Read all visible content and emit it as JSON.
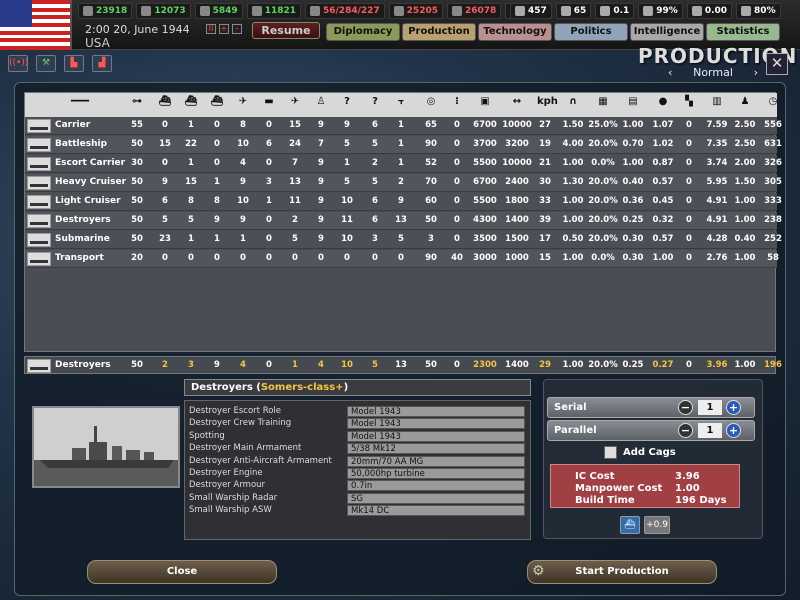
{
  "topbar": {
    "resources": [
      {
        "name": "energy",
        "value": "23918",
        "color": "#5fd35f",
        "icon": "energy-icon"
      },
      {
        "name": "metal",
        "value": "12073",
        "color": "#5fd35f",
        "icon": "metal-icon"
      },
      {
        "name": "rare",
        "value": "5849",
        "color": "#5fd35f",
        "icon": "rare-materials-icon"
      },
      {
        "name": "oil",
        "value": "11821",
        "color": "#5fd35f",
        "icon": "oil-icon"
      },
      {
        "name": "ic",
        "value": "56/284/227",
        "color": "#ff5a5a",
        "icon": "ic-icon"
      },
      {
        "name": "supplies",
        "value": "25205",
        "color": "#ff5a5a",
        "icon": "supplies-icon"
      },
      {
        "name": "fuel",
        "value": "26078",
        "color": "#ff5a5a",
        "icon": "fuel-icon"
      },
      {
        "name": "money",
        "value": "66",
        "color": "#5fd35f",
        "icon": "money-icon"
      }
    ],
    "right_stats": [
      {
        "value": "457",
        "icon": "manpower-icon"
      },
      {
        "value": "65",
        "icon": "diplomats-icon"
      },
      {
        "value": "0.1",
        "icon": "dissent-icon"
      },
      {
        "value": "99%",
        "icon": "national-unity-icon"
      },
      {
        "value": "0.00",
        "icon": "neutrality-icon"
      },
      {
        "value": "80%",
        "icon": "war-support-icon"
      }
    ],
    "date": "2:00 20, June 1944",
    "country": "USA",
    "speed_buttons": [
      "II",
      "+",
      "-"
    ],
    "resume_label": "Resume",
    "tabs": [
      {
        "label": "Diplomacy",
        "color": "#8a9a5a"
      },
      {
        "label": "Production",
        "color": "#b8a070"
      },
      {
        "label": "Technology",
        "color": "#b89090"
      },
      {
        "label": "Politics",
        "color": "#8fa4b8"
      },
      {
        "label": "Intelligence",
        "color": "#a8a8a8"
      },
      {
        "label": "Statistics",
        "color": "#98b890"
      }
    ]
  },
  "subtoolbar": [
    "radio-icon",
    "factory-icon",
    "industry-icon",
    "convoy-icon"
  ],
  "production": {
    "title": "PRODUCTION",
    "mode": "Normal",
    "prev": "‹",
    "next": "›",
    "close": "✕"
  },
  "table": {
    "header_icons": [
      "line-icon",
      "org-chart-icon",
      "carrier-icon",
      "battleship-icon",
      "ship-icon",
      "plane-icon",
      "tank-icon",
      "fighter-icon",
      "infantry-icon",
      "unknown-icon",
      "unknown2-icon",
      "torpedo-icon",
      "target-icon",
      "ammo-icon",
      "armor-icon",
      "range-icon",
      "speed-icon",
      "tunnel-icon",
      "grid-icon",
      "supply-icon",
      "fuel-drop-icon",
      "checker-icon",
      "building-icon",
      "manpower-icon",
      "time-icon"
    ],
    "speed_unit": "kph",
    "rows": [
      {
        "name": "Carrier",
        "vals": [
          "55",
          "0",
          "1",
          "0",
          "8",
          "0",
          "15",
          "9",
          "9",
          "6",
          "1",
          "65",
          "0",
          "6700",
          "10000",
          "27",
          "1.50",
          "25.0%",
          "1.00",
          "1.07",
          "0",
          "7.59",
          "2.50",
          "556"
        ]
      },
      {
        "name": "Battleship",
        "vals": [
          "50",
          "15",
          "22",
          "0",
          "10",
          "6",
          "24",
          "7",
          "5",
          "5",
          "1",
          "90",
          "0",
          "3700",
          "3200",
          "19",
          "4.00",
          "20.0%",
          "0.70",
          "1.02",
          "0",
          "7.35",
          "2.50",
          "631"
        ]
      },
      {
        "name": "Escort Carrier",
        "vals": [
          "30",
          "0",
          "1",
          "0",
          "4",
          "0",
          "7",
          "9",
          "1",
          "2",
          "1",
          "52",
          "0",
          "5500",
          "10000",
          "21",
          "1.00",
          "0.0%",
          "1.00",
          "0.87",
          "0",
          "3.74",
          "2.00",
          "326"
        ]
      },
      {
        "name": "Heavy Cruiser",
        "vals": [
          "50",
          "9",
          "15",
          "1",
          "9",
          "3",
          "13",
          "9",
          "5",
          "5",
          "2",
          "70",
          "0",
          "6700",
          "2400",
          "30",
          "1.30",
          "20.0%",
          "0.40",
          "0.57",
          "0",
          "5.95",
          "1.50",
          "305"
        ]
      },
      {
        "name": "Light Cruiser",
        "vals": [
          "50",
          "6",
          "8",
          "8",
          "10",
          "1",
          "11",
          "9",
          "10",
          "6",
          "9",
          "60",
          "0",
          "5500",
          "1800",
          "33",
          "1.00",
          "20.0%",
          "0.36",
          "0.45",
          "0",
          "4.91",
          "1.00",
          "333"
        ]
      },
      {
        "name": "Destroyers",
        "vals": [
          "50",
          "5",
          "5",
          "9",
          "9",
          "0",
          "2",
          "9",
          "11",
          "6",
          "13",
          "50",
          "0",
          "4300",
          "1400",
          "39",
          "1.00",
          "20.0%",
          "0.25",
          "0.32",
          "0",
          "4.91",
          "1.00",
          "238"
        ]
      },
      {
        "name": "Submarine",
        "vals": [
          "50",
          "23",
          "1",
          "1",
          "1",
          "0",
          "5",
          "9",
          "10",
          "3",
          "5",
          "3",
          "0",
          "3500",
          "1500",
          "17",
          "0.50",
          "20.0%",
          "0.30",
          "0.57",
          "0",
          "4.28",
          "0.40",
          "252"
        ]
      },
      {
        "name": "Transport",
        "vals": [
          "20",
          "0",
          "0",
          "0",
          "0",
          "0",
          "0",
          "0",
          "0",
          "0",
          "0",
          "90",
          "40",
          "3000",
          "1000",
          "15",
          "1.00",
          "0.0%",
          "0.30",
          "1.00",
          "0",
          "2.76",
          "1.00",
          "58"
        ]
      }
    ],
    "selected": {
      "name": "Destroyers",
      "vals": [
        "50",
        "2",
        "3",
        "9",
        "4",
        "0",
        "1",
        "4",
        "10",
        "5",
        "13",
        "50",
        "0",
        "2300",
        "1400",
        "29",
        "1.00",
        "20.0%",
        "0.25",
        "0.27",
        "0",
        "3.96",
        "1.00",
        "196"
      ],
      "highlight": [
        1,
        2,
        4,
        6,
        7,
        8,
        9,
        13,
        15,
        19,
        21,
        23
      ]
    }
  },
  "detail": {
    "title_prefix": "Destroyers (",
    "class_name": "Somers-class+",
    "title_suffix": ")",
    "rows": [
      {
        "k": "Destroyer Escort Role",
        "v": "Model 1943"
      },
      {
        "k": "Destroyer Crew Training",
        "v": "Model 1943"
      },
      {
        "k": "Spotting",
        "v": "Model 1943"
      },
      {
        "k": "Destroyer Main Armament",
        "v": "5/38 Mk12"
      },
      {
        "k": "Destroyer Anti-Aircraft Armament",
        "v": "20mm/70 AA MG"
      },
      {
        "k": "Destroyer Engine",
        "v": "50,000hp turbine"
      },
      {
        "k": "Destroyer Armour",
        "v": "0.7in"
      },
      {
        "k": "Small Warship Radar",
        "v": "SG"
      },
      {
        "k": "Small Warship ASW",
        "v": "Mk14 DC"
      }
    ]
  },
  "controls": {
    "serial": {
      "label": "Serial",
      "value": "1"
    },
    "parallel": {
      "label": "Parallel",
      "value": "1"
    },
    "add_cags": "Add Cags",
    "costs": [
      {
        "k": "IC Cost",
        "v": "3.96"
      },
      {
        "k": "Manpower Cost",
        "v": "1.00"
      },
      {
        "k": "Build Time",
        "v": "196 Days"
      }
    ],
    "small_value": "+0.9"
  },
  "buttons": {
    "close": "Close",
    "start": "Start Production"
  }
}
